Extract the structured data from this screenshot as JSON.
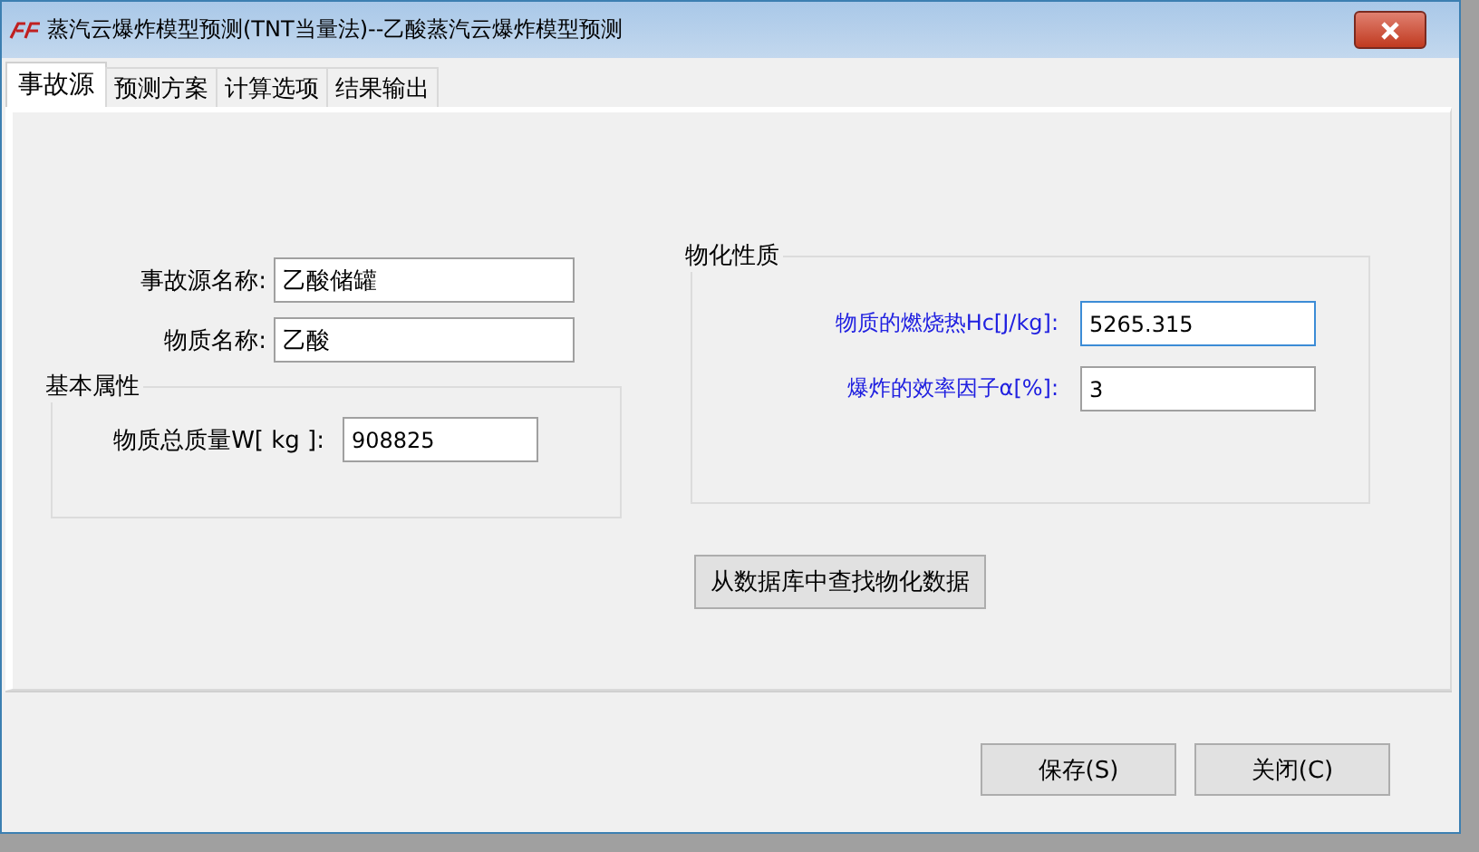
{
  "window": {
    "title": "蒸汽云爆炸模型预测(TNT当量法)--乙酸蒸汽云爆炸模型预测"
  },
  "tabs": [
    {
      "label": "事故源",
      "selected": true
    },
    {
      "label": "预测方案",
      "selected": false
    },
    {
      "label": "计算选项",
      "selected": false
    },
    {
      "label": "结果输出",
      "selected": false
    }
  ],
  "source": {
    "fields": [
      {
        "label": "事故源名称:",
        "value": "乙酸储罐"
      },
      {
        "label": "物质名称:",
        "value": "乙酸"
      }
    ],
    "basic_group": {
      "title": "基本属性",
      "fields": [
        {
          "label": "物质总质量W[ kg ]:",
          "value": "908825"
        }
      ]
    }
  },
  "properties_group": {
    "title": "物化性质",
    "fields": [
      {
        "label": "物质的燃烧热Hc[J/kg]:",
        "value": "5265.315",
        "focused": true
      },
      {
        "label": "爆炸的效率因子α[%]:",
        "value": "3",
        "focused": false
      }
    ]
  },
  "lookup_button": "从数据库中查找物化数据",
  "buttons": [
    "保存(S)",
    "关闭(C)"
  ]
}
